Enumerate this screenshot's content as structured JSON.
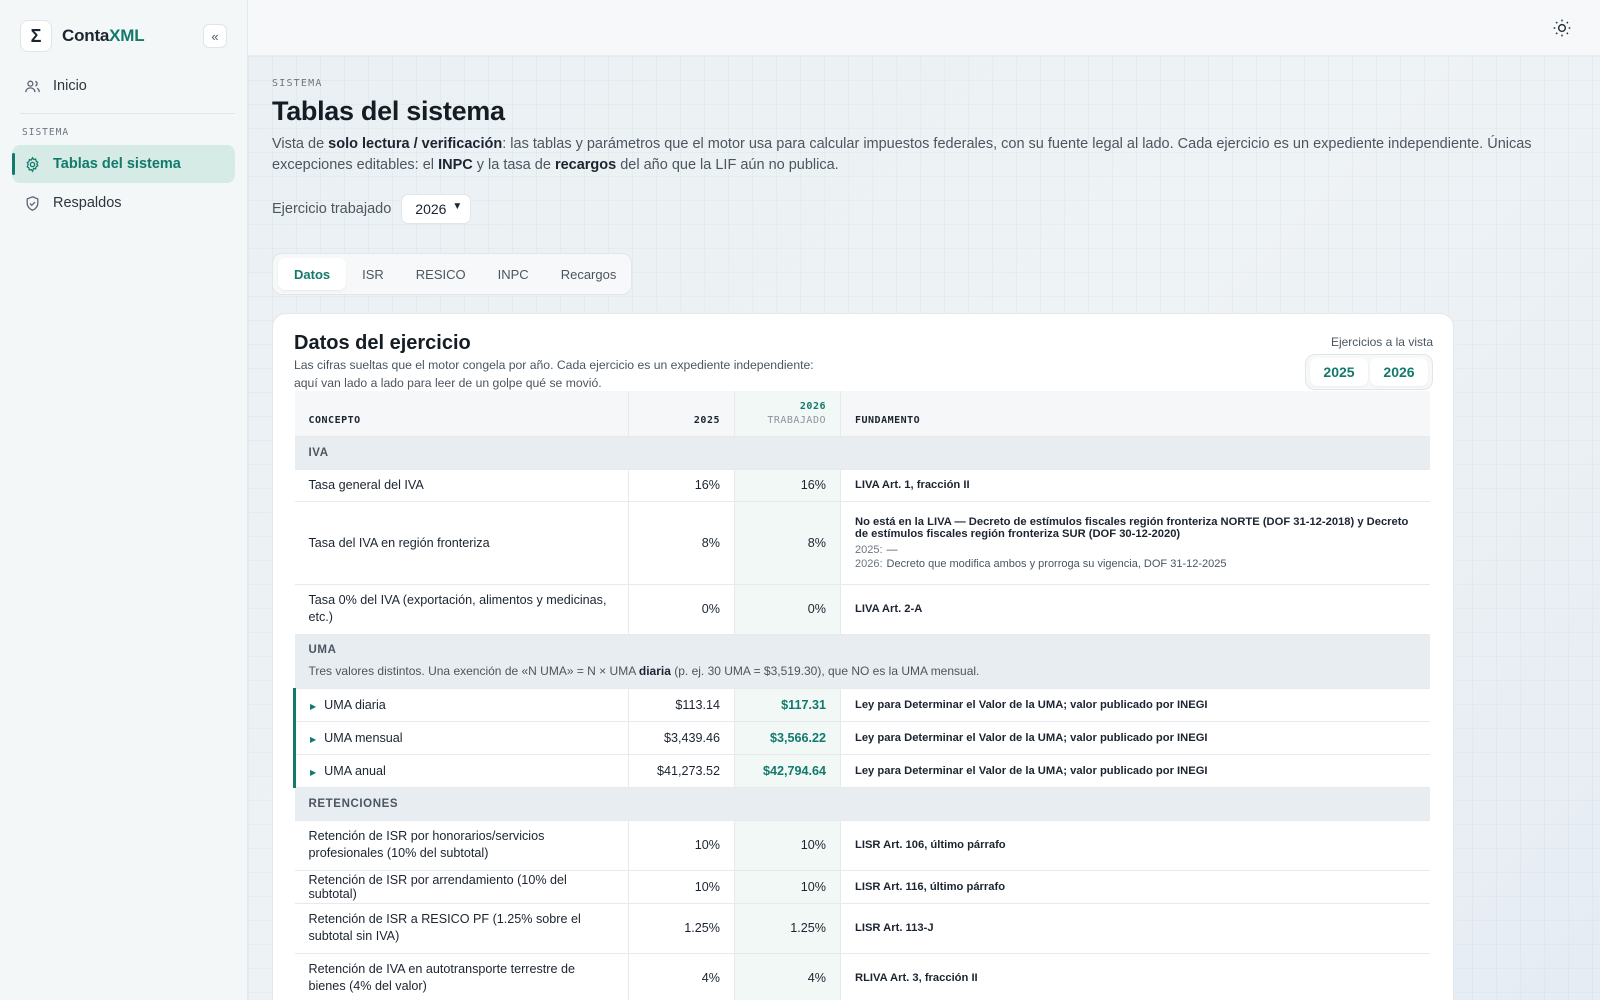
{
  "app": {
    "name_a": "Conta",
    "name_b": "XML",
    "logo_glyph": "Σ",
    "collapse_label": "«"
  },
  "sidebar": {
    "items": [
      {
        "label": "Inicio",
        "icon": "users-icon"
      },
      {
        "label": "Tablas del sistema",
        "icon": "gear-icon",
        "active": true
      },
      {
        "label": "Respaldos",
        "icon": "shield-icon"
      }
    ],
    "section_label": "SISTEMA"
  },
  "header": {
    "theme_icon": "sun-icon"
  },
  "page": {
    "eyebrow": "SISTEMA",
    "title": "Tablas del sistema",
    "desc_1": "Vista de ",
    "desc_b1": "solo lectura / verificación",
    "desc_2": ": las tablas y parámetros que el motor usa para calcular impuestos federales, con su fuente legal al lado. Cada ejercicio es un expediente independiente. Únicas excepciones editables: el ",
    "desc_b2": "INPC",
    "desc_3": " y la tasa de ",
    "desc_b3": "recargos",
    "desc_4": " del año que la LIF aún no publica.",
    "year_label": "Ejercicio trabajado",
    "year_value": "2026"
  },
  "tabs": [
    "Datos",
    "ISR",
    "RESICO",
    "INPC",
    "Recargos"
  ],
  "card": {
    "title": "Datos del ejercicio",
    "desc": "Las cifras sueltas que el motor congela por año. Cada ejercicio es un expediente independiente: aquí van lado a lado para leer de un golpe qué se movió.",
    "view_label": "Ejercicios a la vista",
    "years": [
      "2025",
      "2026"
    ]
  },
  "table": {
    "headers": {
      "concept": "CONCEPTO",
      "y1": "2025",
      "y2": "2026",
      "y2_sub": "TRABAJADO",
      "basis": "FUNDAMENTO"
    },
    "groups": {
      "iva": "IVA",
      "uma": "UMA",
      "uma_desc_1": "Tres valores distintos. Una exención de «N UMA» = N × UMA ",
      "uma_desc_b": "diaria",
      "uma_desc_2": " (p. ej. 30 UMA = $3,519.30), que NO es la UMA mensual.",
      "ret": "RETENCIONES"
    },
    "iva_rows": [
      {
        "concept": "Tasa general del IVA",
        "v1": "16%",
        "v2": "16%",
        "basis": "LIVA Art. 1, fracción II"
      },
      {
        "concept": "Tasa del IVA en región fronteriza",
        "v1": "8%",
        "v2": "8%",
        "basis": "No está en la LIVA — Decreto de estímulos fiscales región fronteriza NORTE (DOF 31-12-2018) y Decreto de estímulos fiscales región fronteriza SUR (DOF 30-12-2020)",
        "note1_year": "2025:",
        "note1_text": "—",
        "note2_year": "2026:",
        "note2_text": "Decreto que modifica ambos y prorroga su vigencia, DOF 31-12-2025"
      },
      {
        "concept": "Tasa 0% del IVA (exportación, alimentos y medicinas, etc.)",
        "v1": "0%",
        "v2": "0%",
        "basis": "LIVA Art. 2-A"
      }
    ],
    "uma_rows": [
      {
        "concept": "UMA diaria",
        "v1": "$113.14",
        "v2": "$117.31",
        "basis": "Ley para Determinar el Valor de la UMA; valor publicado por INEGI"
      },
      {
        "concept": "UMA mensual",
        "v1": "$3,439.46",
        "v2": "$3,566.22",
        "basis": "Ley para Determinar el Valor de la UMA; valor publicado por INEGI"
      },
      {
        "concept": "UMA anual",
        "v1": "$41,273.52",
        "v2": "$42,794.64",
        "basis": "Ley para Determinar el Valor de la UMA; valor publicado por INEGI"
      }
    ],
    "ret_rows": [
      {
        "concept": "Retención de ISR por honorarios/servicios profesionales (10% del subtotal)",
        "v1": "10%",
        "v2": "10%",
        "basis": "LISR Art. 106, último párrafo"
      },
      {
        "concept": "Retención de ISR por arrendamiento (10% del subtotal)",
        "v1": "10%",
        "v2": "10%",
        "basis": "LISR Art. 116, último párrafo"
      },
      {
        "concept": "Retención de ISR a RESICO PF (1.25% sobre el subtotal sin IVA)",
        "v1": "1.25%",
        "v2": "1.25%",
        "basis": "LISR Art. 113-J"
      },
      {
        "concept": "Retención de IVA en autotransporte terrestre de bienes (4% del valor)",
        "v1": "4%",
        "v2": "4%",
        "basis": "RLIVA Art. 3, fracción II"
      }
    ]
  },
  "colors": {
    "accent": "#137a6b",
    "active_bg": "#d6ebe6",
    "group_bg": "#e8edf1"
  }
}
